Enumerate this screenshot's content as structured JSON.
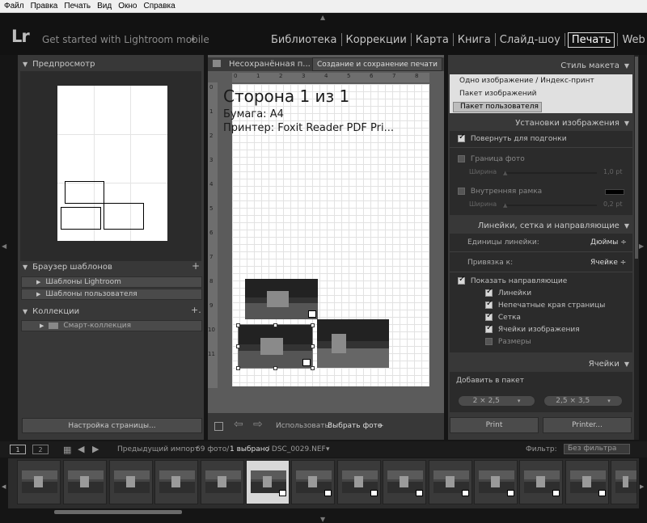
{
  "menu": [
    "Файл",
    "Правка",
    "Печать",
    "Вид",
    "Окно",
    "Справка"
  ],
  "topbar": {
    "logo": "Lr",
    "mobile_text": "Get started with Lightroom mobile",
    "mobile_arrow": "▸",
    "modules": [
      "Библиотека",
      "Коррекции",
      "Карта",
      "Книга",
      "Слайд-шоу",
      "Печать",
      "Web"
    ],
    "active_module": "Печать"
  },
  "left": {
    "preview_title": "Предпросмотр",
    "templates_title": "Браузер шаблонов",
    "templates_add": "+",
    "templates": [
      "Шаблоны Lightroom",
      "Шаблоны пользователя"
    ],
    "collections_title": "Коллекции",
    "collections_add": "+.",
    "collections": [
      "Смарт-коллекция"
    ],
    "page_setup_button": "Настройка страницы..."
  },
  "center": {
    "tab_unsaved": "Несохранённая п...",
    "tab_create": "Создание и сохранение печати",
    "page_title": "Сторона 1 из 1",
    "paper_line": "Бумага:  A4",
    "printer_line": "Принтер:  Foxit Reader PDF Pri...",
    "ruler_top": [
      "0",
      "1",
      "2",
      "3",
      "4",
      "5",
      "6",
      "7",
      "8"
    ],
    "ruler_left": [
      "0",
      "1",
      "2",
      "3",
      "4",
      "5",
      "6",
      "7",
      "8",
      "9",
      "10",
      "11"
    ],
    "use_label": "Использовать:",
    "use_value": "Выбрать фото",
    "use_arrow": "÷"
  },
  "right": {
    "layout_style_title": "Стиль макета",
    "layout_styles": [
      "Одно изображение / Индекс-принт",
      "Пакет изображений",
      "Пакет пользователя"
    ],
    "selected_layout_style": 2,
    "image_settings_title": "Установки изображения",
    "rotate_to_fit": "Повернуть для подгонки",
    "photo_border": "Граница фото",
    "width_label": "Ширина",
    "photo_border_value": "1,0 pt",
    "inner_stroke": "Внутренняя рамка",
    "inner_stroke_value": "0,2 pt",
    "rulers_title": "Линейки, сетка и направляющие",
    "ruler_units_label": "Единицы линейки:",
    "ruler_units_value": "Дюймы ÷",
    "snap_label": "Привязка к:",
    "snap_value": "Ячейке ÷",
    "show_guides": "Показать направляющие",
    "guides": [
      {
        "label": "Линейки",
        "checked": true
      },
      {
        "label": "Непечатные края страницы",
        "checked": true
      },
      {
        "label": "Сетка",
        "checked": true
      },
      {
        "label": "Ячейки изображения",
        "checked": true
      },
      {
        "label": "Размеры",
        "checked": false
      }
    ],
    "cells_title": "Ячейки",
    "add_to_package": "Добавить в пакет",
    "size_buttons": [
      "2 × 2,5",
      "2,5 × 3,5"
    ],
    "print_button": "Print",
    "printer_button": "Printer..."
  },
  "filmbar": {
    "view1": "1",
    "view2": "2",
    "source": "Предыдущий импорт",
    "count": "69 фото/",
    "selected": "1 выбрано",
    "file": "/ DSC_0029.NEF",
    "file_arrow": "▾",
    "filter_label": "Фильтр:",
    "filter_value": "Без фильтра"
  },
  "colors": {
    "panel_bg": "#383838",
    "center_bg": "#5b5b5b",
    "active_module_border": "#d9d9d9"
  }
}
